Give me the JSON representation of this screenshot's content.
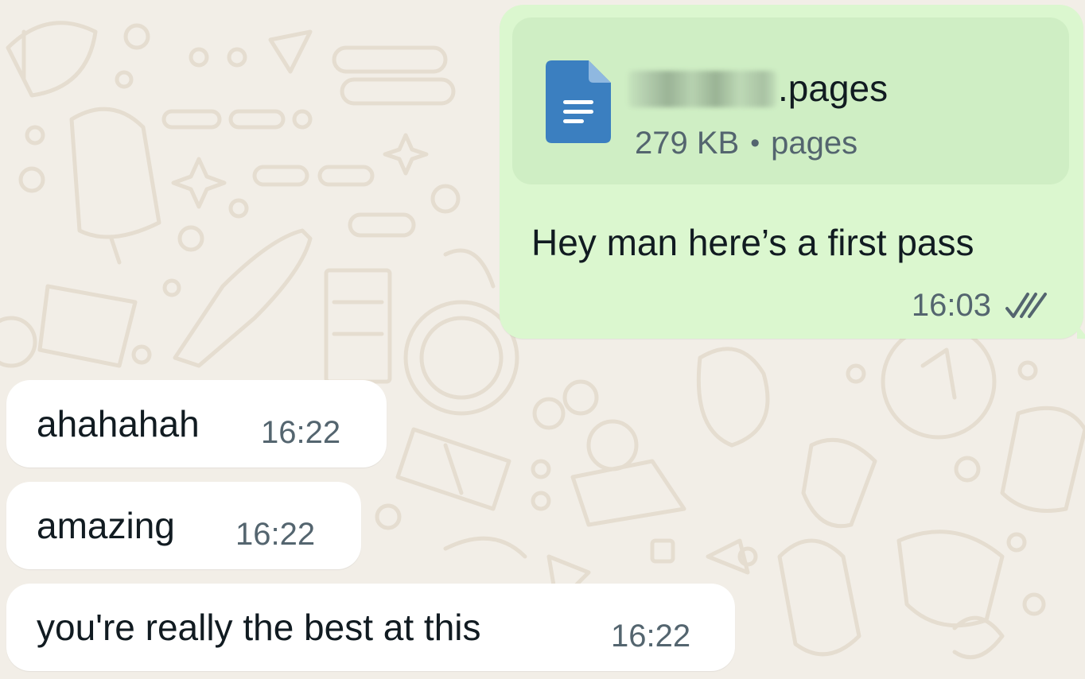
{
  "outgoing_message": {
    "attachment": {
      "file_name_visible": ".pages",
      "file_size": "279 KB",
      "separator": "•",
      "file_type": "pages",
      "icon": "document-icon"
    },
    "text": "Hey man here’s a first pass",
    "time": "16:03",
    "status_icon": "double-check-icon"
  },
  "incoming_messages": [
    {
      "text": "ahahahah",
      "time": "16:22"
    },
    {
      "text": "amazing",
      "time": "16:22"
    },
    {
      "text": "you're really the best at this",
      "time": "16:22"
    }
  ],
  "colors": {
    "background": "#f2eee7",
    "outgoing_bubble": "#dbf7cf",
    "attachment_card": "#cfeec4",
    "incoming_bubble": "#ffffff",
    "document_icon": "#3b7fc0",
    "meta_text": "#54656f"
  }
}
